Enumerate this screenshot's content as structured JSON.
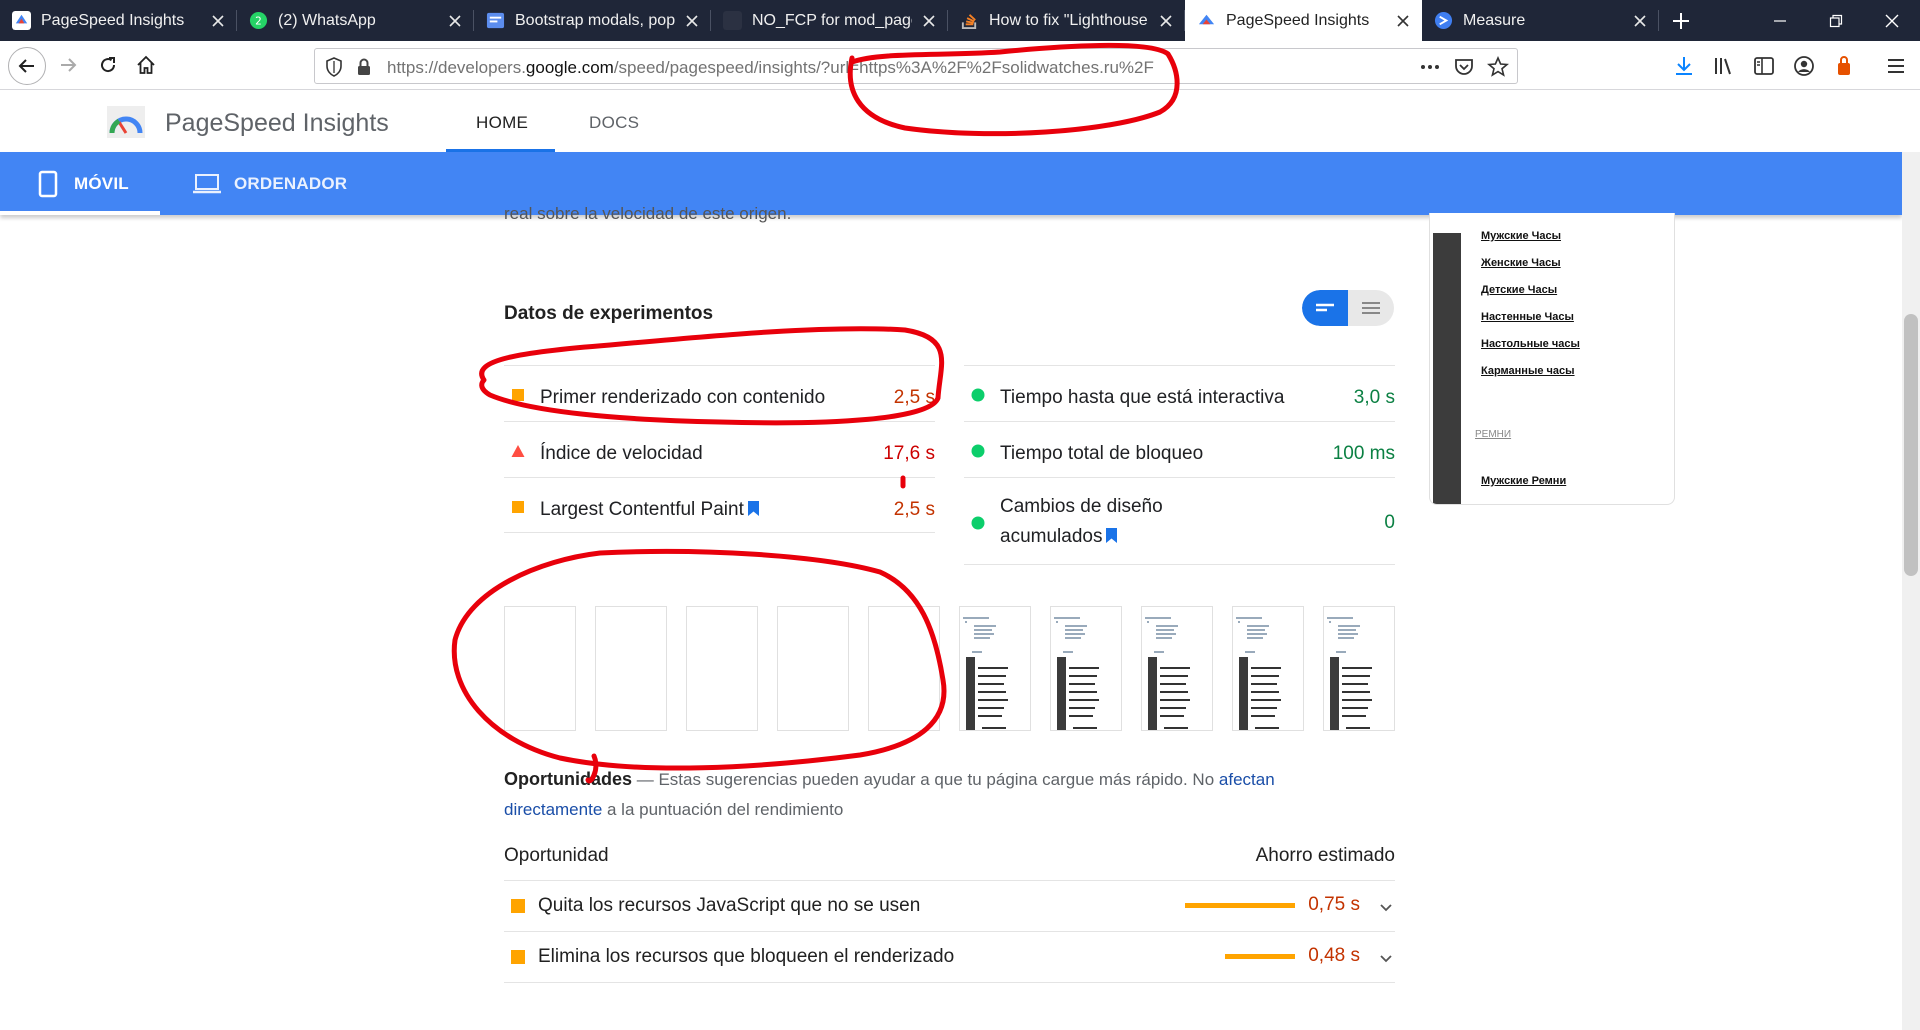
{
  "browser": {
    "tabs": [
      {
        "title": "PageSpeed Insights",
        "icon": "pagespeed-icon",
        "active": false
      },
      {
        "title": "(2) WhatsApp",
        "icon": "whatsapp-icon",
        "active": false
      },
      {
        "title": "Bootstrap modals, popc",
        "icon": "document-icon",
        "active": false
      },
      {
        "title": "NO_FCP for mod_pagesp",
        "icon": "blank-icon",
        "active": false
      },
      {
        "title": "How to fix \"Lighthouse r",
        "icon": "stackoverflow-icon",
        "active": false
      },
      {
        "title": "PageSpeed Insights",
        "icon": "pagespeed-icon",
        "active": true
      },
      {
        "title": "Measure",
        "icon": "lighthouse-icon",
        "active": false
      }
    ],
    "url_prefix": "https://developers.",
    "url_domain": "google.com",
    "url_suffix": "/speed/pagespeed/insights/?url=https%3A%2F%2Fsolidwatches.ru%2F"
  },
  "header": {
    "title": "PageSpeed Insights",
    "nav": [
      "HOME",
      "DOCS"
    ]
  },
  "devices": {
    "mobile": "MÓVIL",
    "desktop": "ORDENADOR"
  },
  "content": {
    "cutoff_text": "real sobre la velocidad de este origen.",
    "section_title": "Datos de experimentos",
    "metrics_left": [
      {
        "name": "Primer renderizado con contenido",
        "value": "2,5 s",
        "status": "average",
        "flag": false
      },
      {
        "name": "Índice de velocidad",
        "value": "17,6 s",
        "status": "fail",
        "flag": false
      },
      {
        "name": "Largest Contentful Paint",
        "value": "2,5 s",
        "status": "average",
        "flag": true
      }
    ],
    "metrics_right": [
      {
        "name": "Tiempo hasta que está interactiva",
        "value": "3,0 s",
        "status": "pass",
        "flag": false
      },
      {
        "name": "Tiempo total de bloqueo",
        "value": "100 ms",
        "status": "pass",
        "flag": false
      },
      {
        "name_line1": "Cambios de diseño",
        "name_line2": "acumulados",
        "value": "0",
        "status": "pass",
        "flag": true
      }
    ],
    "filmstrip": {
      "blank_frames": 5,
      "filled_frames": 5
    },
    "opportunities": {
      "title": "Oportunidades",
      "desc_a": " — Estas sugerencias pueden ayudar a que tu página cargue más rápido. No ",
      "link": "afectan directamente",
      "desc_b": " a la puntuación del rendimiento",
      "col_left": "Oportunidad",
      "col_right": "Ahorro estimado",
      "rows": [
        {
          "name": "Quita los recursos JavaScript que no se usen",
          "saving": "0,75 s",
          "bar_fraction": 1.0
        },
        {
          "name": "Elimina los recursos que bloqueen el renderizado",
          "saving": "0,48 s",
          "bar_fraction": 0.64
        }
      ]
    },
    "preview_links": [
      "Мужские Часы",
      "Женские Часы",
      "Детские Часы",
      "Настенные Часы",
      "Настольные часы",
      "Карманные часы"
    ],
    "preview_section": "РЕМНИ",
    "preview_links2": [
      "Мужские Ремни"
    ]
  },
  "colors": {
    "brand_blue": "#4285f4",
    "average": "#ffa400",
    "fail": "#ff4e42",
    "pass": "#0cce6b",
    "annotation": "#e8000b"
  }
}
